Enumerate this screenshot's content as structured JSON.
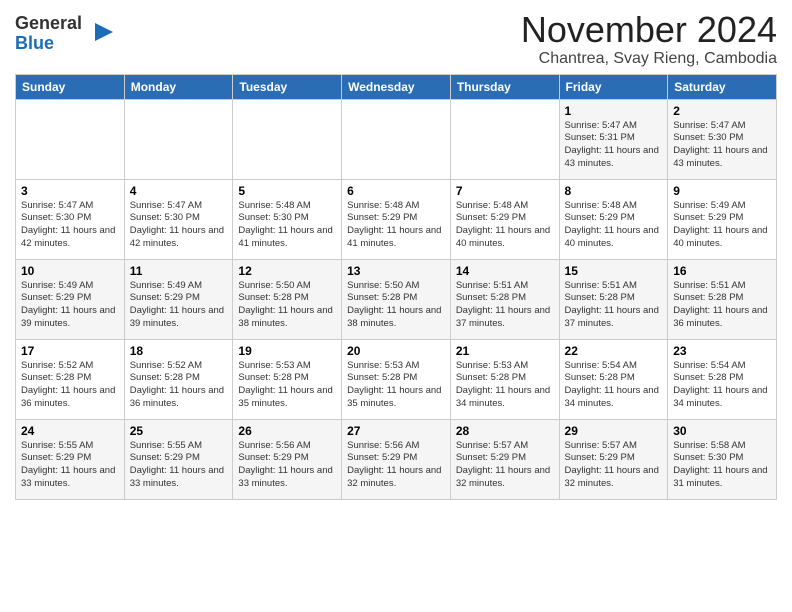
{
  "logo": {
    "general": "General",
    "blue": "Blue"
  },
  "title": "November 2024",
  "location": "Chantrea, Svay Rieng, Cambodia",
  "days_of_week": [
    "Sunday",
    "Monday",
    "Tuesday",
    "Wednesday",
    "Thursday",
    "Friday",
    "Saturday"
  ],
  "weeks": [
    [
      {
        "day": "",
        "info": ""
      },
      {
        "day": "",
        "info": ""
      },
      {
        "day": "",
        "info": ""
      },
      {
        "day": "",
        "info": ""
      },
      {
        "day": "",
        "info": ""
      },
      {
        "day": "1",
        "info": "Sunrise: 5:47 AM\nSunset: 5:31 PM\nDaylight: 11 hours and 43 minutes."
      },
      {
        "day": "2",
        "info": "Sunrise: 5:47 AM\nSunset: 5:30 PM\nDaylight: 11 hours and 43 minutes."
      }
    ],
    [
      {
        "day": "3",
        "info": "Sunrise: 5:47 AM\nSunset: 5:30 PM\nDaylight: 11 hours and 42 minutes."
      },
      {
        "day": "4",
        "info": "Sunrise: 5:47 AM\nSunset: 5:30 PM\nDaylight: 11 hours and 42 minutes."
      },
      {
        "day": "5",
        "info": "Sunrise: 5:48 AM\nSunset: 5:30 PM\nDaylight: 11 hours and 41 minutes."
      },
      {
        "day": "6",
        "info": "Sunrise: 5:48 AM\nSunset: 5:29 PM\nDaylight: 11 hours and 41 minutes."
      },
      {
        "day": "7",
        "info": "Sunrise: 5:48 AM\nSunset: 5:29 PM\nDaylight: 11 hours and 40 minutes."
      },
      {
        "day": "8",
        "info": "Sunrise: 5:48 AM\nSunset: 5:29 PM\nDaylight: 11 hours and 40 minutes."
      },
      {
        "day": "9",
        "info": "Sunrise: 5:49 AM\nSunset: 5:29 PM\nDaylight: 11 hours and 40 minutes."
      }
    ],
    [
      {
        "day": "10",
        "info": "Sunrise: 5:49 AM\nSunset: 5:29 PM\nDaylight: 11 hours and 39 minutes."
      },
      {
        "day": "11",
        "info": "Sunrise: 5:49 AM\nSunset: 5:29 PM\nDaylight: 11 hours and 39 minutes."
      },
      {
        "day": "12",
        "info": "Sunrise: 5:50 AM\nSunset: 5:28 PM\nDaylight: 11 hours and 38 minutes."
      },
      {
        "day": "13",
        "info": "Sunrise: 5:50 AM\nSunset: 5:28 PM\nDaylight: 11 hours and 38 minutes."
      },
      {
        "day": "14",
        "info": "Sunrise: 5:51 AM\nSunset: 5:28 PM\nDaylight: 11 hours and 37 minutes."
      },
      {
        "day": "15",
        "info": "Sunrise: 5:51 AM\nSunset: 5:28 PM\nDaylight: 11 hours and 37 minutes."
      },
      {
        "day": "16",
        "info": "Sunrise: 5:51 AM\nSunset: 5:28 PM\nDaylight: 11 hours and 36 minutes."
      }
    ],
    [
      {
        "day": "17",
        "info": "Sunrise: 5:52 AM\nSunset: 5:28 PM\nDaylight: 11 hours and 36 minutes."
      },
      {
        "day": "18",
        "info": "Sunrise: 5:52 AM\nSunset: 5:28 PM\nDaylight: 11 hours and 36 minutes."
      },
      {
        "day": "19",
        "info": "Sunrise: 5:53 AM\nSunset: 5:28 PM\nDaylight: 11 hours and 35 minutes."
      },
      {
        "day": "20",
        "info": "Sunrise: 5:53 AM\nSunset: 5:28 PM\nDaylight: 11 hours and 35 minutes."
      },
      {
        "day": "21",
        "info": "Sunrise: 5:53 AM\nSunset: 5:28 PM\nDaylight: 11 hours and 34 minutes."
      },
      {
        "day": "22",
        "info": "Sunrise: 5:54 AM\nSunset: 5:28 PM\nDaylight: 11 hours and 34 minutes."
      },
      {
        "day": "23",
        "info": "Sunrise: 5:54 AM\nSunset: 5:28 PM\nDaylight: 11 hours and 34 minutes."
      }
    ],
    [
      {
        "day": "24",
        "info": "Sunrise: 5:55 AM\nSunset: 5:29 PM\nDaylight: 11 hours and 33 minutes."
      },
      {
        "day": "25",
        "info": "Sunrise: 5:55 AM\nSunset: 5:29 PM\nDaylight: 11 hours and 33 minutes."
      },
      {
        "day": "26",
        "info": "Sunrise: 5:56 AM\nSunset: 5:29 PM\nDaylight: 11 hours and 33 minutes."
      },
      {
        "day": "27",
        "info": "Sunrise: 5:56 AM\nSunset: 5:29 PM\nDaylight: 11 hours and 32 minutes."
      },
      {
        "day": "28",
        "info": "Sunrise: 5:57 AM\nSunset: 5:29 PM\nDaylight: 11 hours and 32 minutes."
      },
      {
        "day": "29",
        "info": "Sunrise: 5:57 AM\nSunset: 5:29 PM\nDaylight: 11 hours and 32 minutes."
      },
      {
        "day": "30",
        "info": "Sunrise: 5:58 AM\nSunset: 5:30 PM\nDaylight: 11 hours and 31 minutes."
      }
    ]
  ]
}
